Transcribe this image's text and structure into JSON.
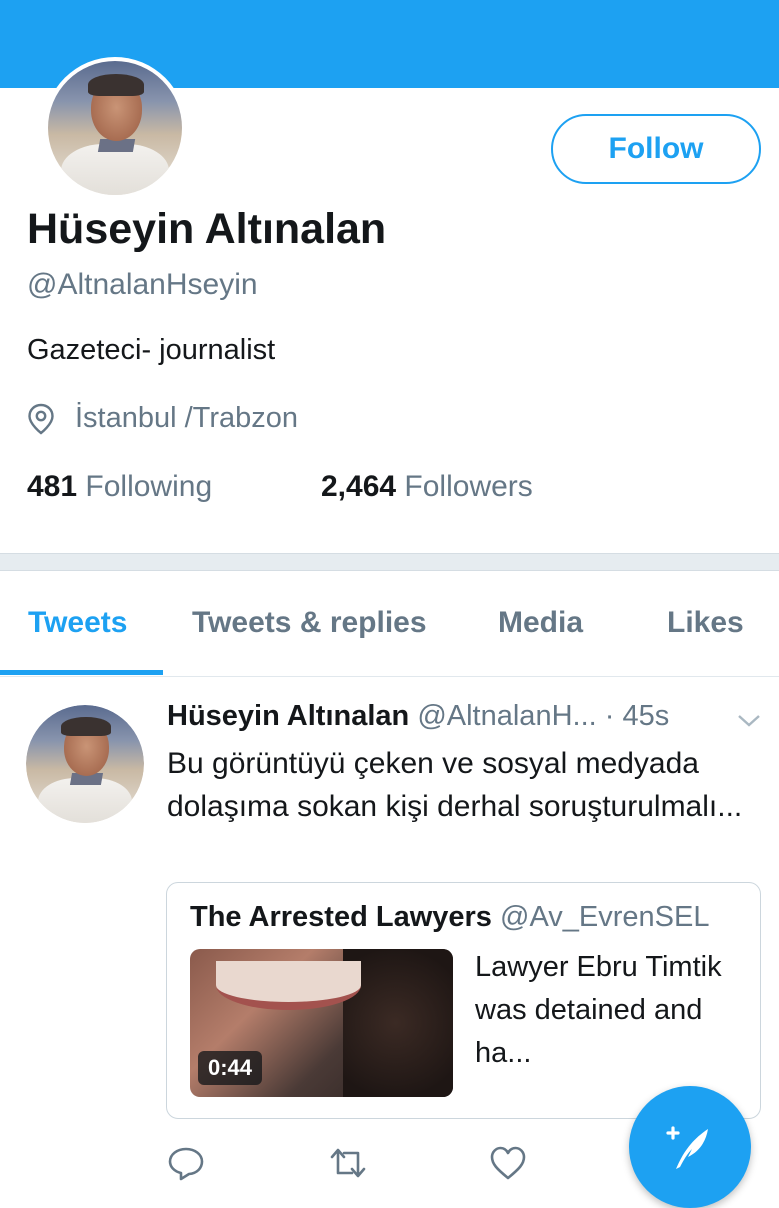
{
  "profile": {
    "display_name": "Hüseyin Altınalan",
    "handle": "@AltnalanHseyin",
    "bio": "Gazeteci- journalist",
    "location": "İstanbul /Trabzon",
    "following_count": "481",
    "following_label": "Following",
    "followers_count": "2,464",
    "followers_label": "Followers",
    "follow_label": "Follow"
  },
  "tabs": [
    {
      "label": "Tweets",
      "active": true
    },
    {
      "label": "Tweets & replies",
      "active": false
    },
    {
      "label": "Media",
      "active": false
    },
    {
      "label": "Likes",
      "active": false
    }
  ],
  "tweet": {
    "name": "Hüseyin Altınalan",
    "handle": "@AltnalanH...",
    "time": "· 45s",
    "text": "Bu görüntüyü çeken ve sosyal medyada dolaşıma sokan kişi derhal soruşturulmalı...",
    "quote": {
      "name": "The Arrested Lawyers",
      "handle": "@Av_EvrenSEL",
      "text": "Lawyer Ebru Timtik was detained and ha...",
      "video_duration": "0:44"
    },
    "actions": [
      "reply-icon",
      "retweet-icon",
      "like-icon"
    ]
  },
  "colors": {
    "accent": "#1da1f2",
    "text_primary": "#14171a",
    "text_secondary": "#657786",
    "divider": "#e6ecf0"
  }
}
